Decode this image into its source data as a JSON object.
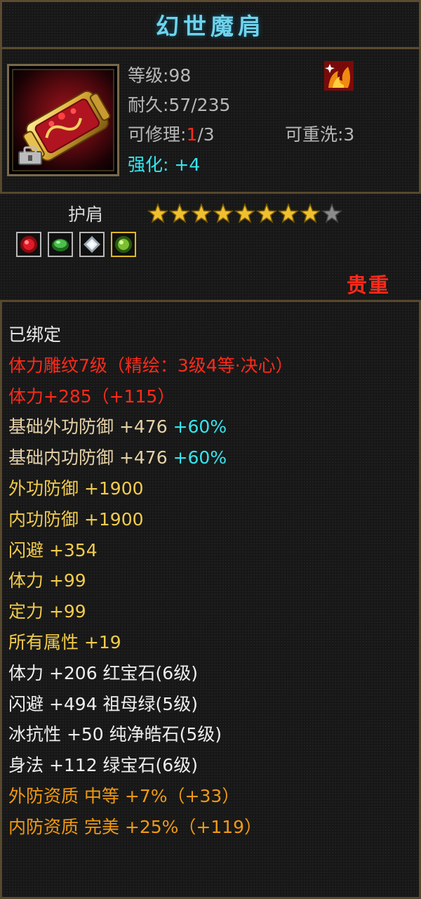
{
  "item": {
    "name": "幻世魔肩",
    "level_text": "等级:98",
    "durability_text": "耐久:57/235",
    "repair_label": "可修理:",
    "repair_used": "1",
    "repair_total": "/3",
    "rewash_text": "可重洗:3",
    "enhance_label": "强化:",
    "enhance_value": "+4",
    "slot": "护肩",
    "stars_filled": 8,
    "stars_total": 9,
    "rarity": "贵重",
    "gems": [
      "red-gem-icon",
      "green-gem-icon",
      "white-gem-icon",
      "green-emerald-gem-icon"
    ]
  },
  "properties": {
    "bound": "已绑定",
    "carving": "体力雕纹7级（精绘：3级4等·决心）",
    "carving_stat": "体力+285（+115）",
    "base_ext_def": "基础外功防御 +476",
    "base_ext_def_pct": " +60%",
    "base_int_def": "基础内功防御 +476",
    "base_int_def_pct": " +60%",
    "ext_def": "外功防御 +1900",
    "int_def": "内功防御 +1900",
    "dodge": "闪避 +354",
    "stamina": "体力 +99",
    "focus": "定力 +99",
    "all_attr": "所有属性 +19",
    "gem1": "体力 +206 红宝石(6级)",
    "gem2": "闪避 +494 祖母绿(5级)",
    "gem3": "冰抗性 +50 纯净皓石(5级)",
    "gem4": "身法 +112 绿宝石(6级)",
    "ext_quality": "外防资质  中等 +7%（+33）",
    "int_quality": "内防资质  完美 +25%（+119）"
  },
  "colors": {
    "title": "#6fd3ee",
    "red": "#ff2a1a",
    "cyan": "#34e6f0",
    "gold": "#f2cc4c",
    "orange": "#f09a14",
    "star_gold": "#f0c030",
    "star_gray": "#8a8a8a"
  }
}
